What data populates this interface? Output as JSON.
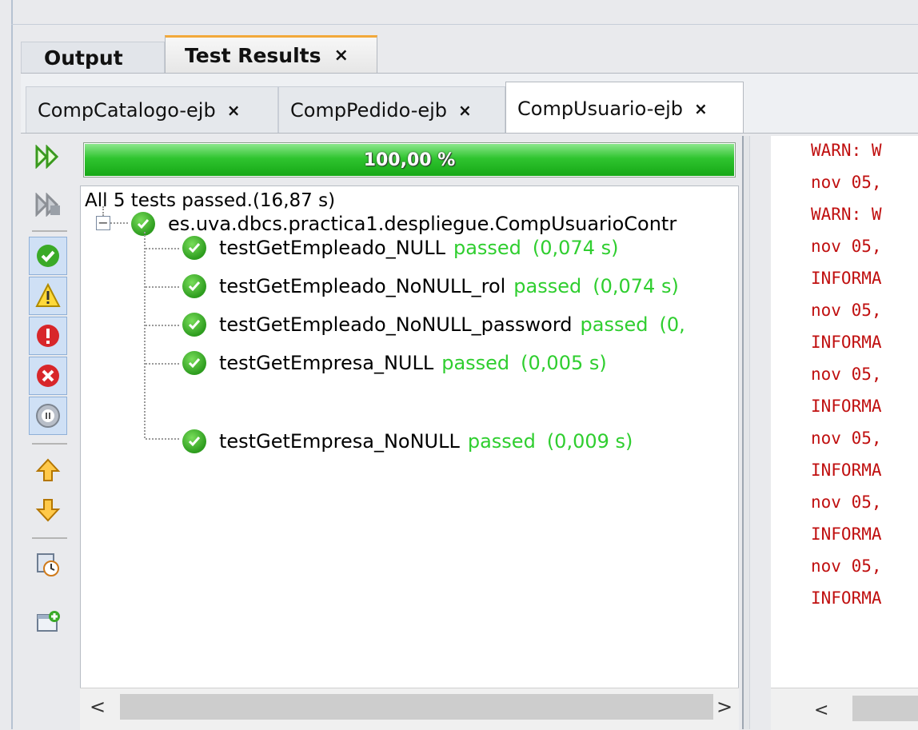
{
  "tabs": {
    "main": [
      {
        "label": "Output"
      },
      {
        "label": "Test Results",
        "close": "×"
      }
    ],
    "sub": [
      {
        "label": "CompCatalogo-ejb",
        "close": "×"
      },
      {
        "label": "CompPedido-ejb",
        "close": "×"
      },
      {
        "label": "CompUsuario-ejb",
        "close": "×"
      }
    ],
    "active_main": "Test Results",
    "active_sub": "CompUsuario-ejb"
  },
  "progress": {
    "label": "100,00 %",
    "fraction": 1.0
  },
  "summary": "All 5 tests passed.(16,87 s)",
  "suite": {
    "name": "es.uva.dbcs.practica1.despliegue.CompUsuarioContr"
  },
  "tests": [
    {
      "name": "testGetEmpleado_NULL",
      "status": "passed",
      "time": "(0,074 s)"
    },
    {
      "name": "testGetEmpleado_NoNULL_rol",
      "status": "passed",
      "time": "(0,074 s)"
    },
    {
      "name": "testGetEmpleado_NoNULL_password",
      "status": "passed",
      "time": "(0,"
    },
    {
      "name": "testGetEmpresa_NULL",
      "status": "passed",
      "time": "(0,005 s)"
    },
    {
      "name": "testGetEmpresa_NoNULL",
      "status": "passed",
      "time": "(0,009 s)"
    }
  ],
  "console": {
    "lines": [
      "WARN: W",
      "nov 05,",
      "WARN: W",
      "nov 05,",
      "INFORMA",
      "nov 05,",
      "INFORMA",
      "nov 05,",
      "INFORMA",
      "nov 05,",
      "INFORMA",
      "nov 05,",
      "INFORMA",
      "nov 05,",
      "INFORMA"
    ]
  },
  "scroll": {
    "left": "<",
    "right": ">"
  },
  "colors": {
    "accent_tab": "#f2a93b",
    "pass_green": "#2fce2f",
    "console_text": "#c01010",
    "progress_green": "#2fc42f"
  },
  "toolbar_icons": [
    "rerun-icon",
    "rerun-failed-icon",
    "show-passed-icon",
    "show-warnings-icon",
    "show-failures-icon",
    "show-errors-icon",
    "show-aborted-icon",
    "previous-failure-icon",
    "next-failure-icon",
    "test-history-icon",
    "new-test-icon"
  ]
}
